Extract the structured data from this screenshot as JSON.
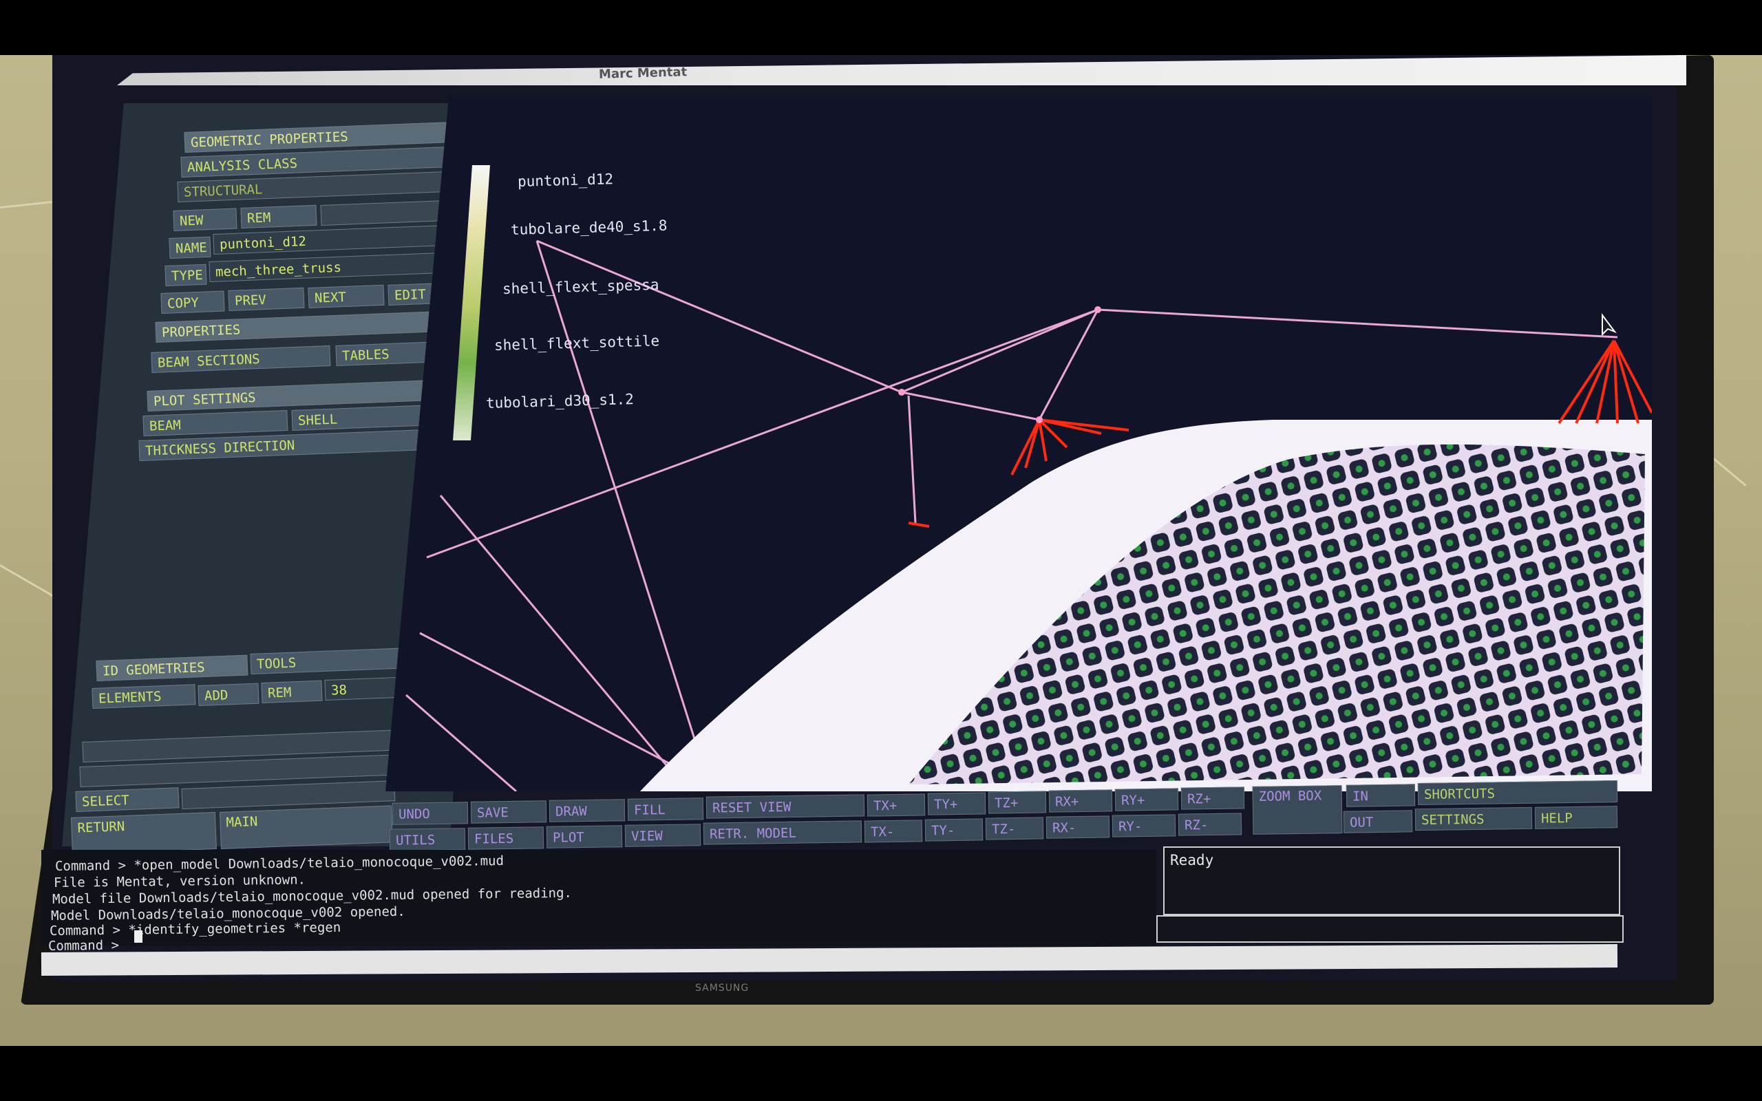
{
  "window": {
    "title": "Marc Mentat"
  },
  "left_panel": {
    "header_geometric_properties": "GEOMETRIC PROPERTIES",
    "analysis_class": "ANALYSIS CLASS",
    "structural": "STRUCTURAL",
    "new_label": "NEW",
    "rem_label": "REM",
    "name_label": "NAME",
    "name_value": "puntoni_d12",
    "type_label": "TYPE",
    "type_value": "mech_three_truss",
    "copy_label": "COPY",
    "prev_label": "PREV",
    "next_label": "NEXT",
    "edit_label": "EDIT",
    "properties_label": "PROPERTIES",
    "beam_sections": "BEAM SECTIONS",
    "tables_label": "TABLES",
    "plot_settings": "PLOT SETTINGS",
    "beam_label": "BEAM",
    "shell_label": "SHELL",
    "thickness_direction": "THICKNESS DIRECTION",
    "id_geometries": "ID GEOMETRIES",
    "tools_label": "TOOLS",
    "elements_label": "ELEMENTS",
    "add_label": "ADD",
    "rem2_label": "REM",
    "count_value": "38",
    "select_label": "SELECT",
    "return_label": "RETURN",
    "main_label": "MAIN"
  },
  "legend": {
    "items": [
      "puntoni_d12",
      "tubolare_de40_s1.8",
      "shell_flext_spessa",
      "shell_flext_sottile",
      "tubolari_d30_s1.2"
    ]
  },
  "toolbar": {
    "row1": [
      "UNDO",
      "SAVE",
      "DRAW",
      "FILL",
      "RESET VIEW",
      "TX+",
      "TY+",
      "TZ+",
      "RX+",
      "RY+",
      "RZ+"
    ],
    "row2": [
      "UTILS",
      "FILES",
      "PLOT",
      "VIEW",
      "RETR. MODEL",
      "TX-",
      "TY-",
      "TZ-",
      "RX-",
      "RY-",
      "RZ-"
    ],
    "zoom_box": "ZOOM BOX",
    "in_label": "IN",
    "out_label": "OUT",
    "shortcuts": "SHORTCUTS",
    "settings": "SETTINGS",
    "help": "HELP"
  },
  "console": {
    "lines": [
      "Command > *open_model Downloads/telaio_monocoque_v002.mud",
      "File is Mentat, version unknown.",
      "Model file Downloads/telaio_monocoque_v002.mud opened for reading.",
      "Model Downloads/telaio_monocoque_v002 opened.",
      "Command > *identify_geometries *regen",
      "Command > "
    ]
  },
  "status": {
    "text": "Ready"
  },
  "monitor": {
    "brand": "SAMSUNG"
  },
  "colors": {
    "viewport_bg": "#111428",
    "wire": "#e9a7d6",
    "truss_red": "#ff2a10",
    "shell_white": "#f4f2f8",
    "mesh_green": "#2f9a44",
    "button_text": "#cfe36a"
  }
}
